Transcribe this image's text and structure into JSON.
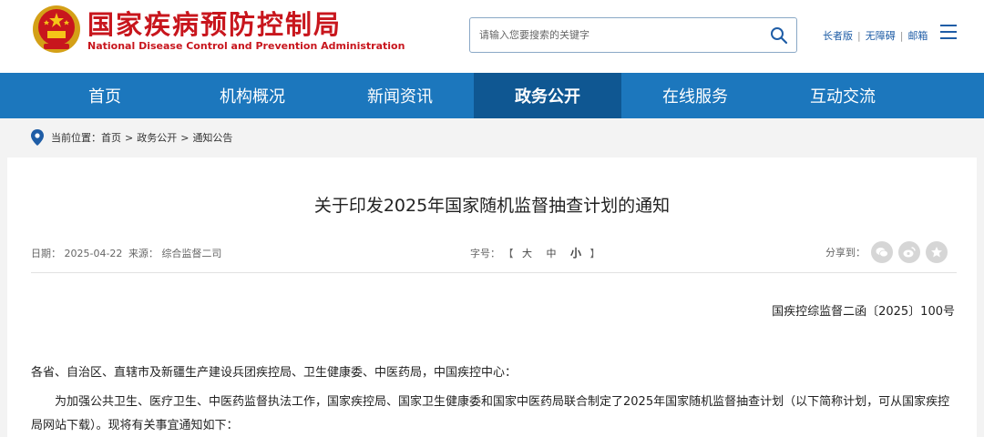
{
  "header": {
    "org_name_cn": "国家疾病预防控制局",
    "org_name_en": "National Disease Control and Prevention Administration",
    "search_placeholder": "请输入您要搜索的关键字",
    "links": [
      "长者版",
      "无障碍",
      "邮箱"
    ],
    "brand_color": "#c8161d"
  },
  "nav": {
    "items": [
      "首页",
      "机构概况",
      "新闻资讯",
      "政务公开",
      "在线服务",
      "互动交流"
    ],
    "active": "政务公开",
    "bg_color": "#1c77bd",
    "active_color": "#0f5792"
  },
  "breadcrumb": {
    "label": "当前位置：",
    "items": [
      "首页",
      "政务公开",
      "通知公告"
    ]
  },
  "article": {
    "title": "关于印发2025年国家随机监督抽查计划的通知",
    "date_label": "日期：",
    "date": "2025-04-22",
    "source_label": "来源：",
    "source": "综合监督二司",
    "fontsize_label": "字号：",
    "fontsize_open": "【",
    "fontsize_options": [
      "大",
      "中",
      "小"
    ],
    "fontsize_close": "】",
    "share_label": "分享到：",
    "share_icons": [
      "wechat-icon",
      "weibo-icon",
      "favorite-icon"
    ],
    "doc_number": "国疾控综监督二函〔2025〕100号",
    "addressee": "各省、自治区、直辖市及新疆生产建设兵团疾控局、卫生健康委、中医药局，中国疾控中心：",
    "paragraph_1": "为加强公共卫生、医疗卫生、中医药监督执法工作，国家疾控局、国家卫生健康委和国家中医药局联合制定了2025年国家随机监督抽查计划（以下简称计划，可从国家疾控局网站下载）。现将有关事宜通知如下："
  }
}
